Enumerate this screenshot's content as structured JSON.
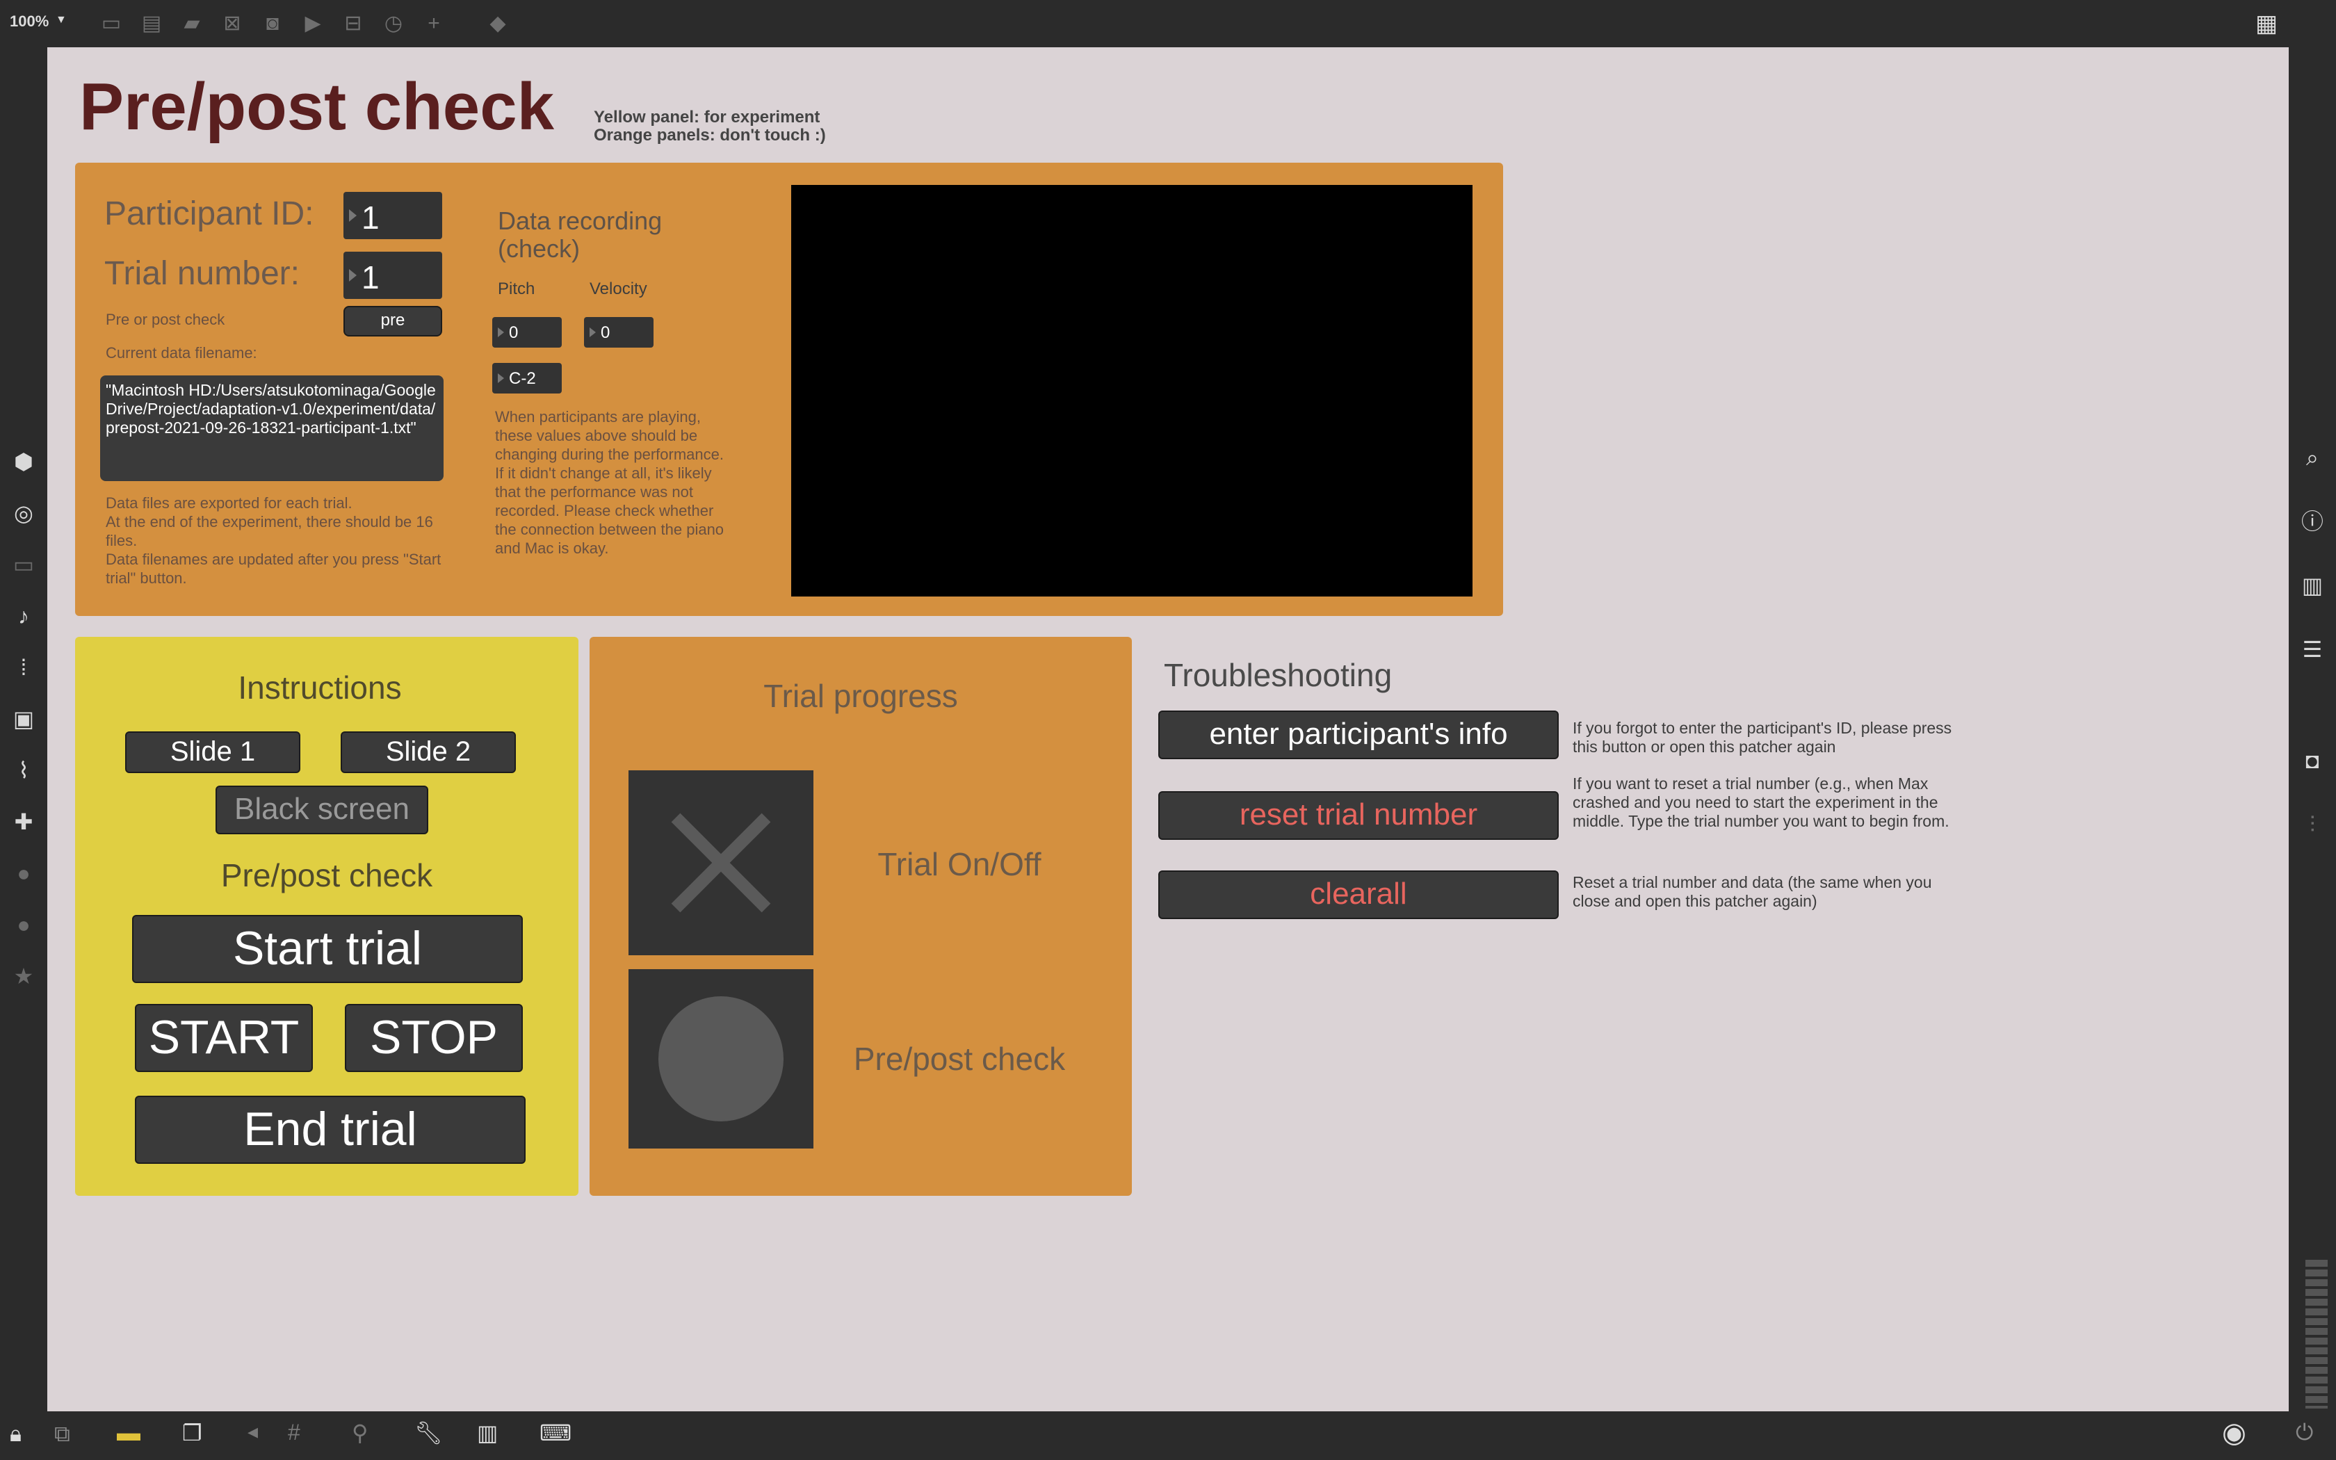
{
  "toolbar": {
    "zoom": "100%"
  },
  "page": {
    "title": "Pre/post check",
    "legend_line1": "Yellow panel: for experiment",
    "legend_line2": "Orange panels: don't touch :)"
  },
  "data_panel": {
    "participant_label": "Participant ID:",
    "participant_value": "1",
    "trial_label": "Trial number:",
    "trial_value": "1",
    "prepost_label": "Pre or post check",
    "prepost_button": "pre",
    "filename_label": "Current data filename:",
    "filename_value": "\"Macintosh HD:/Users/atsukotominaga/Google Drive/Project/adaptation-v1.0/experiment/data/prepost-2021-09-26-18321-participant-1.txt\"",
    "note_1": "Data files are exported for each trial.",
    "note_2": "At the end of the experiment, there should be 16 files.",
    "note_3": "Data filenames are updated after you press \"Start trial\" button.",
    "recording_title": "Data recording (check)",
    "pitch_label": "Pitch",
    "velocity_label": "Velocity",
    "pitch_value": "0",
    "velocity_value": "0",
    "note_name": "C-2",
    "recording_note": "When participants are playing, these values above should be changing during the performance. If it didn't change at all, it's likely that the performance was not recorded. Please check whether the connection between the piano and Mac is okay."
  },
  "instructions": {
    "title": "Instructions",
    "slide1": "Slide 1",
    "slide2": "Slide 2",
    "black_screen": "Black screen",
    "prepost_heading": "Pre/post check",
    "start_trial": "Start trial",
    "start": "START",
    "stop": "STOP",
    "end_trial": "End trial"
  },
  "progress": {
    "title": "Trial progress",
    "trial_onoff": "Trial On/Off",
    "prepost": "Pre/post check"
  },
  "troubleshooting": {
    "title": "Troubleshooting",
    "enter_btn": "enter participant's info",
    "enter_note": "If you forgot to enter the participant's ID, please press this button or open this patcher again",
    "reset_btn": "reset trial number",
    "reset_note": "If you want to reset a trial number (e.g., when Max crashed and you need to start the experiment in the middle. Type the trial number you want to begin from.",
    "clear_btn": "clearall",
    "clear_note": "Reset a trial number and data (the same when you close and open this patcher again)"
  },
  "colors": {
    "orange_panel": "#d4903f",
    "yellow_panel": "#e0cf42",
    "title": "#5a1f1f",
    "red_text": "#e8655e",
    "canvas": "#dbd3d6"
  }
}
